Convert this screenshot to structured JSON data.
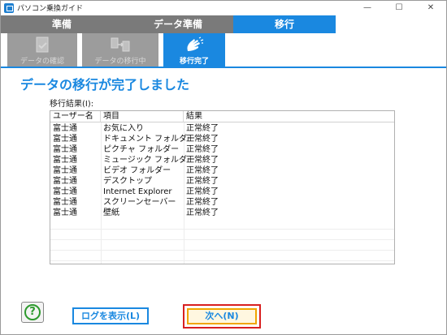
{
  "window": {
    "title": "パソコン乗換ガイド",
    "controls": {
      "minimize": "—",
      "maximize": "☐",
      "close": "✕"
    }
  },
  "steps": [
    {
      "label": "準備"
    },
    {
      "label": "データ準備"
    },
    {
      "label": "移行"
    }
  ],
  "substeps": [
    {
      "label": "データの確認",
      "icon": "document-check-icon"
    },
    {
      "label": "データの移行中",
      "icon": "transfer-icon"
    },
    {
      "label": "移行完了",
      "icon": "hands-clap-icon"
    }
  ],
  "main": {
    "title": "データの移行が完了しました",
    "result_label": "移行結果(I):"
  },
  "table": {
    "headers": [
      "ユーザー名",
      "項目",
      "結果"
    ],
    "rows": [
      [
        "富士通",
        "お気に入り",
        "正常終了"
      ],
      [
        "富士通",
        "ドキュメント フォルダー",
        "正常終了"
      ],
      [
        "富士通",
        "ピクチャ フォルダー",
        "正常終了"
      ],
      [
        "富士通",
        "ミュージック フォルダー",
        "正常終了"
      ],
      [
        "富士通",
        "ビデオ フォルダー",
        "正常終了"
      ],
      [
        "富士通",
        "デスクトップ",
        "正常終了"
      ],
      [
        "富士通",
        "Internet Explorer",
        "正常終了"
      ],
      [
        "富士通",
        "スクリーンセーバー",
        "正常終了"
      ],
      [
        "富士通",
        "壁紙",
        "正常終了"
      ]
    ]
  },
  "buttons": {
    "help": "?",
    "show_log": "ログを表示(L)",
    "next": "次へ(N)"
  },
  "colors": {
    "accent": "#1a88e0",
    "inactive": "#7a7a7a",
    "highlight": "#d82020",
    "focus": "#f0a500"
  }
}
